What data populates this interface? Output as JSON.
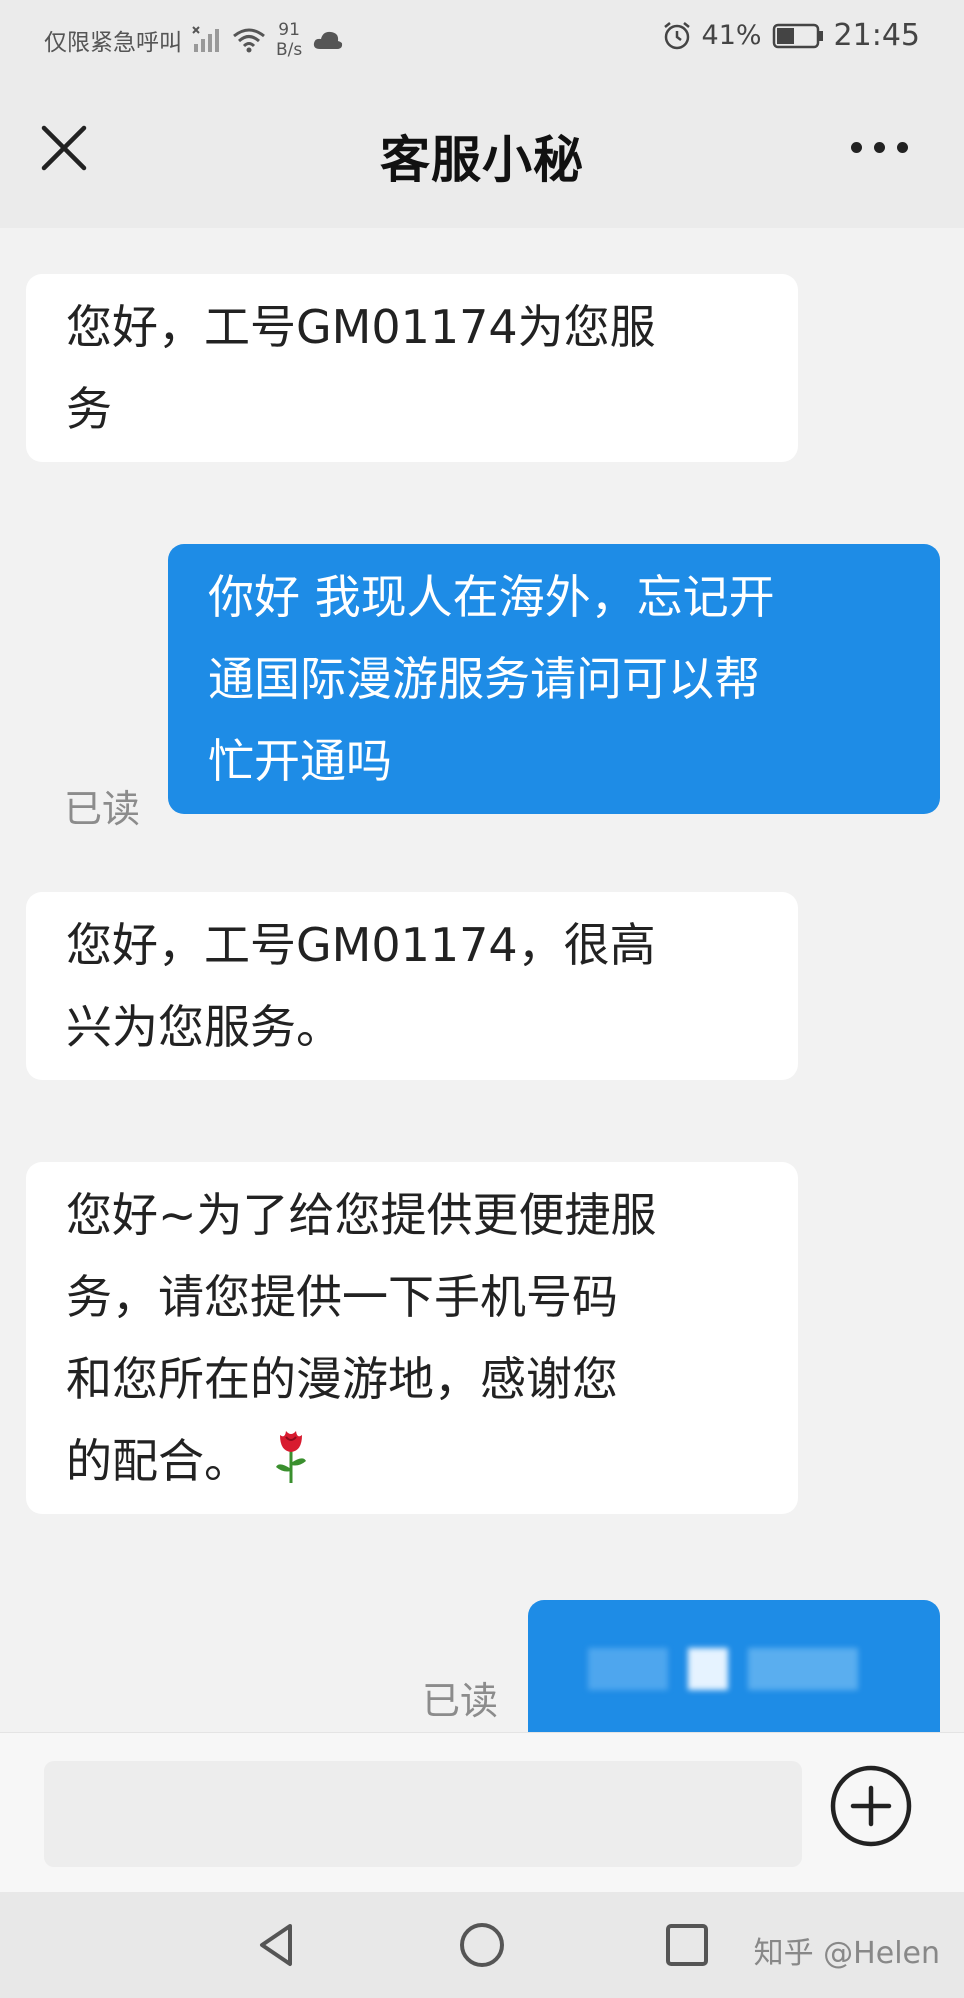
{
  "status_bar": {
    "carrier": "仅限紧急呼叫",
    "net_speed_value": "91",
    "net_speed_unit": "B/s",
    "battery": "41%",
    "time": "21:45",
    "icons": [
      "signal-icon",
      "wifi-icon",
      "cloud-icon",
      "alarm-icon",
      "battery-icon"
    ]
  },
  "header": {
    "title": "客服小秘",
    "close_icon": "close-icon",
    "more_icon": "more-icon"
  },
  "messages": [
    {
      "side": "in",
      "lines": [
        "您好，工号GM01174为您服",
        "务"
      ]
    },
    {
      "side": "out",
      "lines": [
        "你好 我现人在海外，忘记开",
        "通国际漫游服务请问可以帮",
        "忙开通吗"
      ],
      "status": "已读"
    },
    {
      "side": "in",
      "lines": [
        "您好，工号GM01174，很高",
        "兴为您服务。"
      ]
    },
    {
      "side": "in",
      "lines": [
        "您好~为了给您提供更便捷服",
        "务，请您提供一下手机号码",
        "和您所在的漫游地，感谢您",
        "的配合。"
      ],
      "emoji": "rose-icon"
    },
    {
      "side": "out",
      "lines": [],
      "status": "已读",
      "redacted": true
    }
  ],
  "input": {
    "placeholder": "",
    "plus_icon": "plus-circle-icon"
  },
  "nav": {
    "icons": [
      "back-triangle-icon",
      "home-circle-icon",
      "recents-square-icon"
    ],
    "watermark": "知乎 @Helen"
  },
  "colors": {
    "outgoing_bubble": "#1e8ce6",
    "incoming_bubble": "#ffffff",
    "background": "#f2f2f2"
  }
}
